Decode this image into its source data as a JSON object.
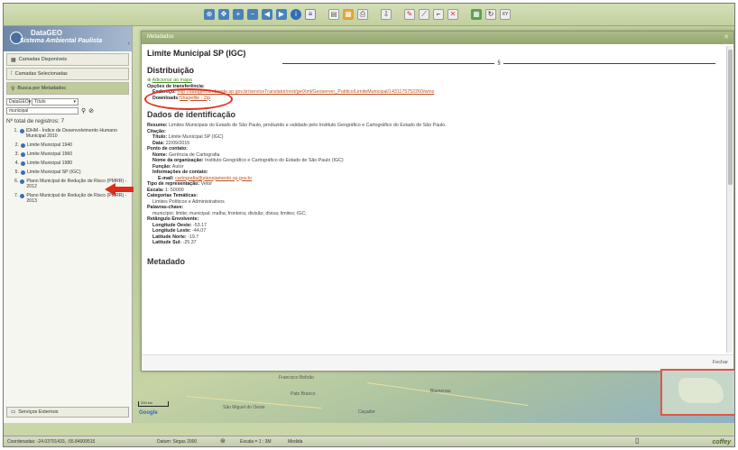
{
  "app": {
    "logo_line1": "DataGEO",
    "logo_line2": "Sistema Ambiental Paulista"
  },
  "sidebar": {
    "accordion": [
      {
        "label": "Camadas Disponíveis",
        "icon": "layers-icon"
      },
      {
        "label": "Camadas Selecionadas",
        "icon": "list-icon"
      },
      {
        "label": "Busca por Metadados",
        "icon": "search-icon"
      }
    ],
    "search": {
      "source": "DataGEO",
      "field": "Título",
      "query": "municipal"
    },
    "total_label": "Nº total de registros: 7",
    "results": [
      {
        "num": "1.",
        "text": "IDHM - Índice de Desenvolvimento Humano Municipal 2010"
      },
      {
        "num": "2.",
        "text": "Limite Municipal 1940"
      },
      {
        "num": "3.",
        "text": "Limite Municipal 1960"
      },
      {
        "num": "4.",
        "text": "Limite Municipal 1980"
      },
      {
        "num": "5.",
        "text": "Limite Municipal SP (IGC)"
      },
      {
        "num": "6.",
        "text": "Plano Municipal de Redução de Risco (PMRR) - 2012"
      },
      {
        "num": "7.",
        "text": "Plano Municipal de Redução de Risco (PMRR) - 2013"
      }
    ],
    "services_label": "Serviços Externos"
  },
  "metadata": {
    "window_title": "Metadados",
    "layer_title": "Limite Municipal SP (IGC)",
    "section_mark": "§",
    "dist_heading": "Distribuição",
    "add_to_map": "Adicionar ao mapa",
    "transfer_label": "Opções de transferência:",
    "endereco_label": "Endereço:",
    "endereco_value": "http://datageo.ambiente.sp.gov.br/serviceTranslator/rest/getXml/Geoserver_Publico/LimiteMunicipal/1431175752260/wms",
    "downloads_label": "Downloads:",
    "downloads_value": "Shapefile - Zip",
    "ident_heading": "Dados de identificação",
    "resumo_label": "Resumo:",
    "resumo_value": "Limites Municipais do Estado de São Paulo, produzido e validado pelo Instituto Geográfico e Cartográfico do Estado de São Paulo.",
    "citacao_label": "Citação:",
    "titulo_label": "Título:",
    "titulo_value": "Limite Municipal SP (IGC)",
    "data_label": "Data:",
    "data_value": "22/09/2015",
    "contato_label": "Ponto de contato:",
    "nome_label": "Nome:",
    "nome_value": "Gerência de Cartografia",
    "org_label": "Nome da organização:",
    "org_value": "Instituto Geográfico e Cartográfico do Estado de São Paulo (IGC)",
    "funcao_label": "Função:",
    "funcao_value": "Autor",
    "info_contato_label": "Informações de contato:",
    "email_label": "E-mail:",
    "email_value": "cartografia@planejamento.sp.gov.br",
    "tipo_label": "Tipo de representação:",
    "tipo_value": "Vetor",
    "escala_label": "Escala:",
    "escala_value": "1: 50000",
    "cat_label": "Categorias Temáticas:",
    "cat_value": "Limites Políticos e Administrativos",
    "palavras_label": "Palavras-chave:",
    "palavras_value": "município; limite; municipal; malha; fronteira; divisão; divisa; limites; IGC;",
    "ret_label": "Retângulo Envolvente:",
    "oeste_label": "Longitude Oeste:",
    "oeste_value": "-53.17",
    "leste_label": "Longitude Leste:",
    "leste_value": "-44.07",
    "norte_label": "Latitude Norte:",
    "norte_value": "-19.7",
    "sul_label": "Latitude Sul:",
    "sul_value": "-25.37",
    "metadado_heading": "Metadado",
    "fechar": "Fechar"
  },
  "map": {
    "labels": [
      "Francisco Beltrão",
      "Pato Branco",
      "São Miguel do Oeste",
      "Blumenau",
      "Caçador"
    ],
    "scale_label": "200 km",
    "google": "Google"
  },
  "status": {
    "coords": "Coordenadas: -24.03701433, -55.84009515",
    "datum": "Datum: Sirgas 2000",
    "escala": "Escala = 1 : 3M",
    "medida": "Medida",
    "brand": "coffey"
  }
}
